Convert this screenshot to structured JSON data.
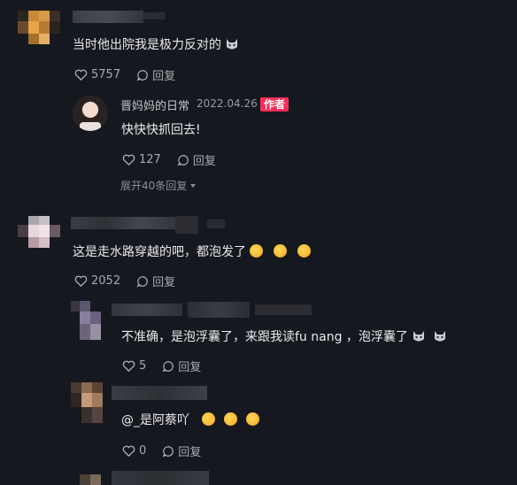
{
  "comments": [
    {
      "text": "当时他出院我是极力反对的",
      "likes": "5757",
      "reply_label": "回复",
      "emoji": [
        "cat-face"
      ],
      "replies": [
        {
          "author": "晋妈妈的日常",
          "date": "2022.04.26",
          "badge": "作者",
          "text": "快快快抓回去!",
          "likes": "127",
          "reply_label": "回复"
        }
      ],
      "expand_label": "展开40条回复"
    },
    {
      "text": "这是走水路穿越的吧，都泡发了",
      "likes": "2052",
      "reply_label": "回复",
      "emoji": [
        "rolling-laugh",
        "rolling-laugh",
        "rolling-laugh"
      ],
      "replies": [
        {
          "text": "不准确，是泡浮囊了，来跟我读fu nang ，泡浮囊了",
          "likes": "5",
          "reply_label": "回复",
          "emoji": [
            "cat-face",
            "cat-face"
          ]
        },
        {
          "text": "@_是阿蔡吖",
          "likes": "0",
          "reply_label": "回复",
          "emoji": [
            "rolling-laugh",
            "rolling-laugh",
            "rolling-laugh"
          ]
        }
      ]
    }
  ],
  "colors": {
    "background": "#16181f",
    "author_badge": "#fe2c55",
    "meta_text": "#a8a9ad"
  }
}
